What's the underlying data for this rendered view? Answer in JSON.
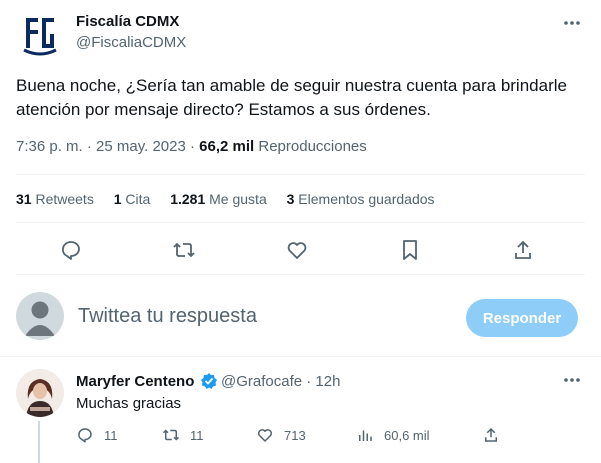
{
  "author": {
    "name": "Fiscalía CDMX",
    "handle": "@FiscaliaCDMX",
    "logo_color": "#0b2a5e"
  },
  "tweet": {
    "text": "Buena noche, ¿Sería tan amable de seguir nuestra cuenta para brindarle atención por mensaje directo? Estamos a sus órdenes.",
    "time": "7:36 p. m. · 25 may. 2023 · ",
    "views_count": "66,2 mil",
    "views_label": " Reproducciones"
  },
  "stats": {
    "retweets_count": "31",
    "retweets_label": " Retweets",
    "quotes_count": "1",
    "quotes_label": " Cita",
    "likes_count": "1.281",
    "likes_label": " Me gusta",
    "bookmarks_count": "3",
    "bookmarks_label": " Elementos guardados"
  },
  "actions": [
    "reply-icon",
    "retweet-icon",
    "like-icon",
    "bookmark-icon",
    "share-icon"
  ],
  "composer": {
    "placeholder": "Twittea tu respuesta",
    "button_label": "Responder",
    "button_color": "#8ecdf8"
  },
  "reply": {
    "name": "Maryfer Centeno",
    "handle_time": "@Grafocafe · 12h",
    "text": "Muchas gracias",
    "replies": "11",
    "retweets": "11",
    "likes": "713",
    "views": "60,6 mil",
    "verified_color": "#1d9bf0"
  }
}
